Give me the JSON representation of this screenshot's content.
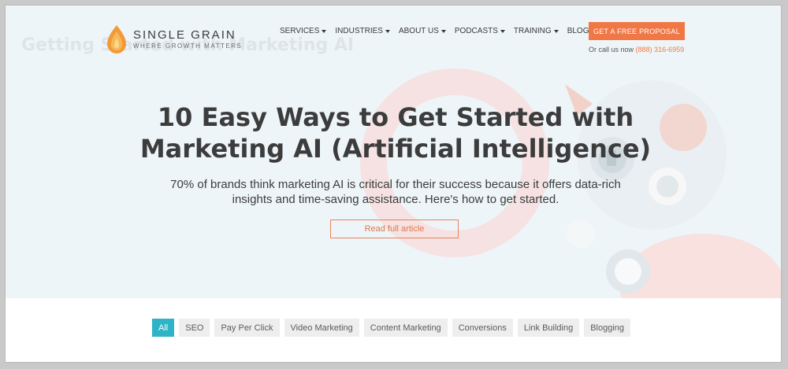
{
  "ghost_title": "Getting Started with Marketing AI",
  "logo": {
    "name": "SINGLE GRAIN",
    "tagline": "WHERE GROWTH MATTERS"
  },
  "nav": {
    "items": [
      {
        "label": "SERVICES",
        "dropdown": true
      },
      {
        "label": "INDUSTRIES",
        "dropdown": true
      },
      {
        "label": "ABOUT US",
        "dropdown": true
      },
      {
        "label": "PODCASTS",
        "dropdown": true
      },
      {
        "label": "TRAINING",
        "dropdown": true
      },
      {
        "label": "BLOG",
        "dropdown": false
      }
    ],
    "cta_label": "GET A FREE PROPOSAL",
    "phone_prefix": "Or call us now",
    "phone_number": "(888) 316-6959"
  },
  "hero": {
    "headline": "10 Easy Ways to Get Started with Marketing AI (Artificial Intelligence)",
    "subheadline": "70% of brands think marketing AI is critical for their success because it offers data-rich insights and time-saving assistance. Here's how to get started.",
    "read_button": "Read full article"
  },
  "filters": {
    "items": [
      "All",
      "SEO",
      "Pay Per Click",
      "Video Marketing",
      "Content Marketing",
      "Conversions",
      "Link Building",
      "Blogging"
    ],
    "active": "All"
  },
  "colors": {
    "accent": "#f07846",
    "active_filter": "#2fb3c6",
    "hero_bg": "#eef5f8"
  }
}
